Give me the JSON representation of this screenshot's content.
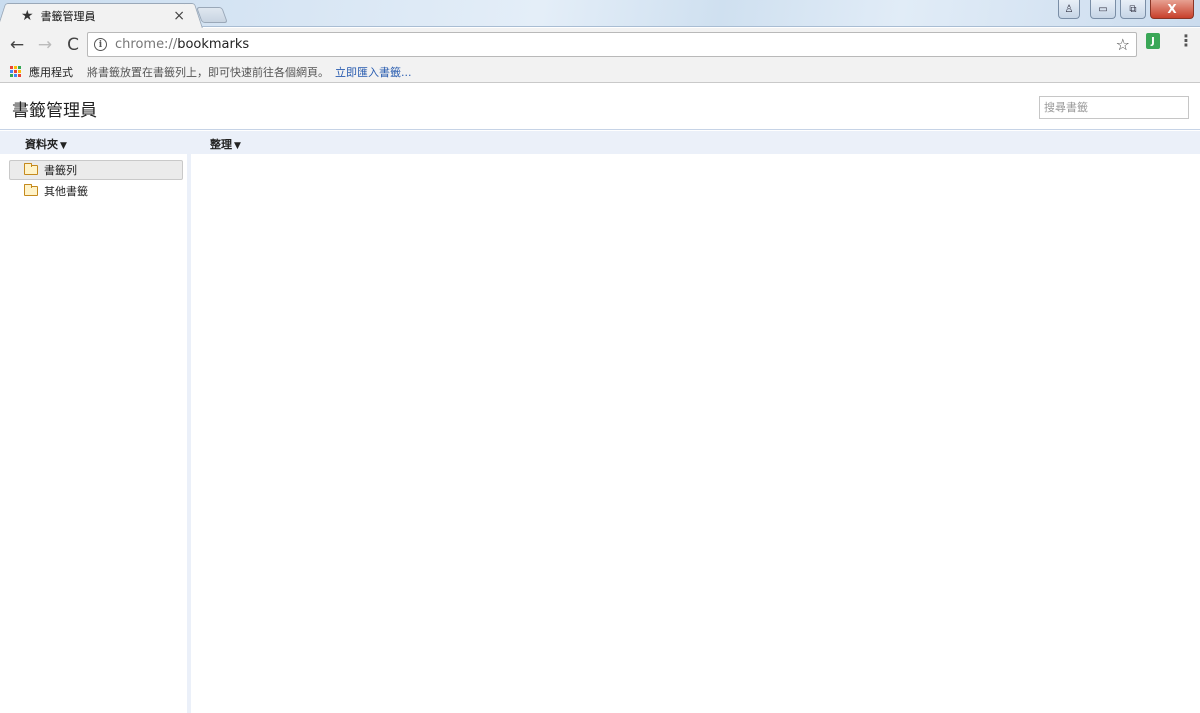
{
  "window": {
    "tab_title": "書籤管理員",
    "tab_close_glyph": "×",
    "minimize_glyph": "▭",
    "restore_glyph": "⧉",
    "close_glyph": "X",
    "user_glyph": "♙"
  },
  "toolbar": {
    "back_glyph": "←",
    "forward_glyph": "→",
    "reload_glyph": "C",
    "info_glyph": "i",
    "url_scheme": "chrome://",
    "url_host": "bookmarks",
    "star_glyph": "☆",
    "menu_glyph": "⋮"
  },
  "bookmark_bar": {
    "apps_label": "應用程式",
    "hint": "將書籤放置在書籤列上，即可快速前往各個網頁。",
    "import_link": "立即匯入書籤..."
  },
  "page": {
    "title": "書籤管理員",
    "search_placeholder": "搜尋書籤"
  },
  "menus": {
    "folders": "資料夾",
    "organize": "整理"
  },
  "tree": {
    "items": [
      {
        "label": "書籤列",
        "selected": true
      },
      {
        "label": "其他書籤",
        "selected": false
      }
    ]
  },
  "colors": {
    "apps_grid": [
      "#ea4335",
      "#fbbc05",
      "#34a853",
      "#4285f4",
      "#ea4335",
      "#fbbc05",
      "#34a853",
      "#4285f4",
      "#ea4335"
    ]
  }
}
